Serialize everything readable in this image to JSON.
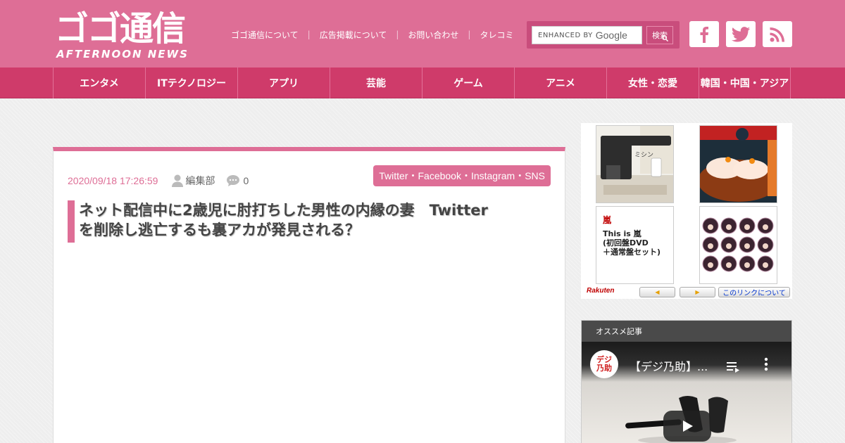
{
  "site": {
    "logo_main": "ゴゴ通信",
    "logo_sub": "AFTERNOON NEWS"
  },
  "header_links": [
    "ゴゴ通信について",
    "広告掲載について",
    "お問い合わせ",
    "タレコミ"
  ],
  "search": {
    "prefix": "ENHANCED BY",
    "brand": "Google",
    "button_label": "検索"
  },
  "social": [
    "facebook-icon",
    "twitter-icon",
    "rss-icon"
  ],
  "nav": [
    "エンタメ",
    "ITテクノロジー",
    "アプリ",
    "芸能",
    "ゲーム",
    "アニメ",
    "女性・恋愛",
    "韓国・中国・アジア"
  ],
  "article": {
    "date": "2020/09/18 17:26:59",
    "author": "編集部",
    "comments": "0",
    "category": "Twitter・Facebook・Instagram・SNS",
    "title_line1": "ネット配信中に2歳児に肘打ちした男性の内縁の妻　Twitter",
    "title_line2": "を削除し逃亡するも裏アカが発見される？"
  },
  "ad": {
    "cell1_text": "ミシン",
    "cell3_title": "嵐",
    "cell3_line1": "This is 嵐",
    "cell3_line2": "(初回盤DVD",
    "cell3_line3": "＋通常盤セット)",
    "logo": "Rakuten",
    "link_label": "このリンクについて",
    "prev_label": "◀",
    "next_label": "▶"
  },
  "recommend": {
    "heading": "オススメ記事",
    "video_title": "【デジ乃助】...",
    "channel_name": "デジ乃助"
  },
  "colors": {
    "header_pink": "#de6e96",
    "nav_pink": "#cf3b6a",
    "search_pink": "#c94d7c"
  }
}
